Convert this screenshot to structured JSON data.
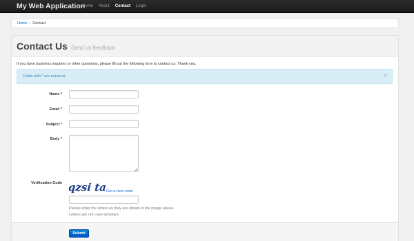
{
  "navbar": {
    "brand": "My Web Application",
    "items": [
      {
        "label": "Home",
        "active": false
      },
      {
        "label": "About",
        "active": false
      },
      {
        "label": "Contact",
        "active": true
      },
      {
        "label": "Login",
        "active": false
      }
    ]
  },
  "breadcrumb": {
    "home": "Home",
    "separator": "/",
    "current": "Contact"
  },
  "page": {
    "title": "Contact Us",
    "subtitle": "Send us feedback",
    "intro": "If you have business inquiries or other questions, please fill out the following form to contact us. Thank you."
  },
  "alert": {
    "text": "Fields with * are required.",
    "close": "×"
  },
  "form": {
    "name_label": "Name *",
    "email_label": "Email *",
    "subject_label": "Subject *",
    "body_label": "Body *",
    "verification_label": "Verification Code",
    "captcha_text": "qzsi tag",
    "captcha_link": "Got a new code",
    "hint_line1": "Please enter the letters as they are shown in the image above.",
    "hint_line2": "Letters are not case-sensitive.",
    "submit_label": "Submit"
  },
  "colors": {
    "navbar": "#1b1b1b",
    "link": "#0069d6",
    "alert_bg": "#d9edf7",
    "alert_text": "#3a87ad",
    "submit": "#0074cc"
  }
}
